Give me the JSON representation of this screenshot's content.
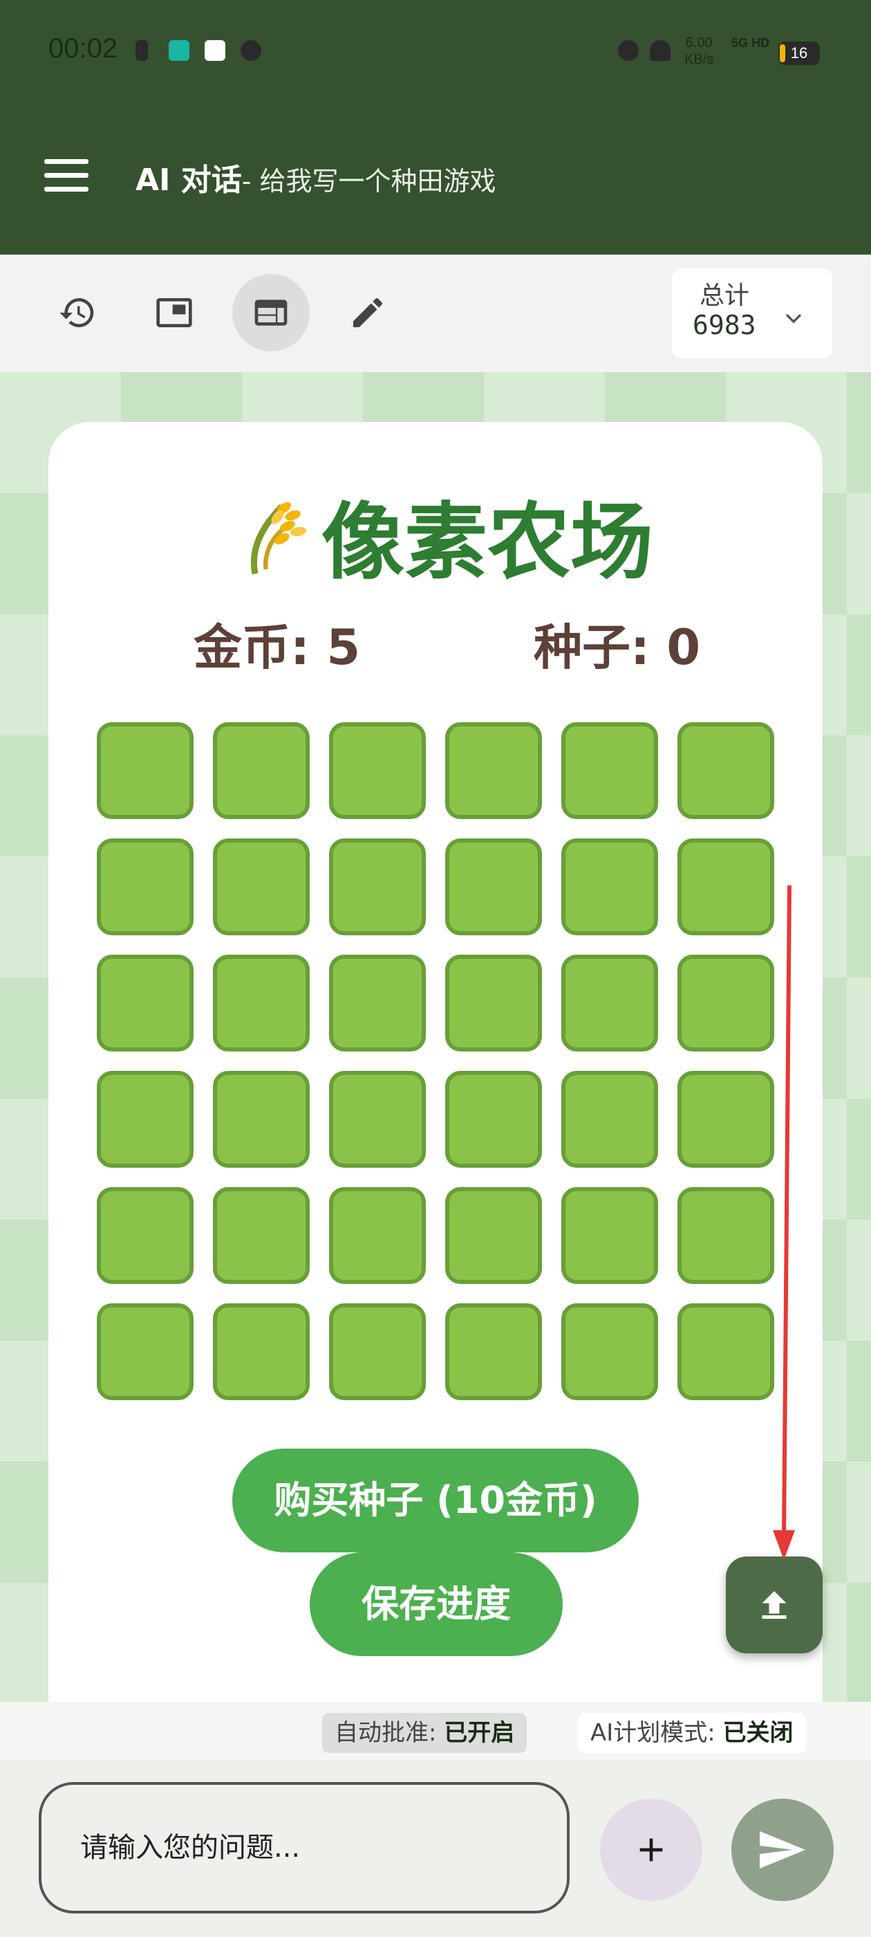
{
  "status_bar": {
    "time": "00:02",
    "net_speed_value": "6.00",
    "net_speed_unit": "KB/s",
    "network": "5G HD",
    "battery": "16"
  },
  "app_bar": {
    "title": "AI 对话",
    "subtitle": "- 给我写一个种田游戏"
  },
  "toolbar": {
    "total_label": "总计",
    "total_value": "6983"
  },
  "game": {
    "title": "像素农场",
    "coins_label": "金币: 5",
    "seeds_label": "种子: 0",
    "grid_rows": 6,
    "grid_cols": 6,
    "plot_color": "#8bc34a",
    "plot_border_color": "#689f38",
    "buy_button": "购买种子 (10金币)",
    "save_button": "保存进度"
  },
  "status_chips": {
    "auto_approve_label": "自动批准: ",
    "auto_approve_value": "已开启",
    "plan_mode_label": "AI计划模式: ",
    "plan_mode_value": "已关闭"
  },
  "input": {
    "placeholder": "请输入您的问题..."
  },
  "colors": {
    "app_bar": "#35512f",
    "accent_green": "#4caf50",
    "title_green": "#2e7d32",
    "annotation_arrow": "#e53935"
  }
}
